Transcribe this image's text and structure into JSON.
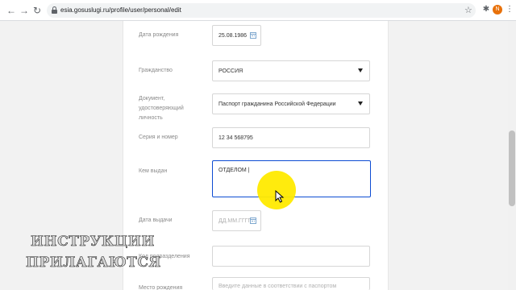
{
  "browser": {
    "url": "esia.gosuslugi.ru/profile/user/personal/edit",
    "nav": {
      "back": "←",
      "forward": "→",
      "reload": "↻"
    },
    "avatar_letter": "N",
    "icons": {
      "star": "☆",
      "extensions": "✱",
      "menu": "⋮"
    }
  },
  "form": {
    "birth_date": {
      "label": "Дата рождения",
      "value": "25.08.1986"
    },
    "citizenship": {
      "label": "Гражданство",
      "value": "РОССИЯ"
    },
    "document": {
      "label_line1": "Документ,",
      "label_line2": "удостоверяющий",
      "label_line3": "личность",
      "value": "Паспорт гражданина Российской Федерации"
    },
    "series_number": {
      "label": "Серия и номер",
      "value": "12 34 568795"
    },
    "issued_by": {
      "label": "Кем выдан",
      "value": "ОТДЕЛОМ |"
    },
    "issue_date": {
      "label": "Дата выдачи",
      "placeholder": "ДД.ММ.ГГГГ"
    },
    "division_code": {
      "label": "Код подразделения",
      "value": ""
    },
    "birth_place": {
      "label": "Место рождения",
      "placeholder": "Введите данные в соответствии с паспортом"
    }
  },
  "watermark": {
    "line1": "ИНСТРУКЦИИ",
    "line2": "ПРИЛАГАЮТСЯ"
  },
  "colors": {
    "accent": "#0d4cd3",
    "highlight": "#ffea00",
    "avatar": "#e8710a"
  }
}
